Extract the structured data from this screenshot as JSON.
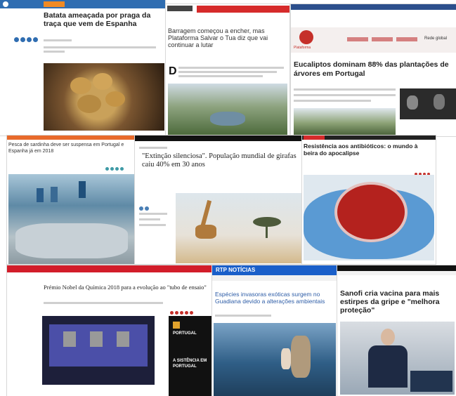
{
  "collage": {
    "tile1": {
      "title": "Batata ameaçada por praga da traça que vem de Espanha",
      "brand_color": "#2f6db1",
      "image": "hands holding potatoes"
    },
    "tile2": {
      "title": "Barragem começou a encher, mas Plataforma Salvar o Tua diz que vai continuar a lutar",
      "image": "dam valley"
    },
    "tile3": {
      "section_label": "Plataforma",
      "promo_right": "Rede global",
      "title": "Eucaliptos dominam 88% das plantações de árvores em Portugal",
      "accent": "#c5302a"
    },
    "tile4": {
      "title": "Pesca de sardinha deve ser suspensa em Portugal e Espanha já em 2018",
      "brand_color": "#e86a2b"
    },
    "tile5": {
      "title": "\"Extinção silenciosa\". População mundial de girafas caiu 40% em 30 anos",
      "image": "giraffe on savanna"
    },
    "tile6": {
      "title": "Resistência aos antibióticos: o mundo à beira do apocalipse",
      "image": "gloved hand holding petri dish"
    },
    "tile7": {
      "title": "Prémio Nobel da Química 2018 para a evolução ao \"tubo de ensaio\"",
      "ad_lines": [
        "PORTUGAL",
        "A SISTÊNCIA EM PORTUGAL"
      ],
      "image": "presentation screen"
    },
    "tile8": {
      "brand": "RTP NOTÍCIAS",
      "title": "Espécies invasoras exóticas surgem no Guadiana devido a alterações ambientais",
      "brand_color": "#1a5fc9"
    },
    "tile9": {
      "title": "Sanofi cria vacina para mais estirpes da gripe e \"melhora proteção\"",
      "image": "man speaking at podium"
    }
  }
}
